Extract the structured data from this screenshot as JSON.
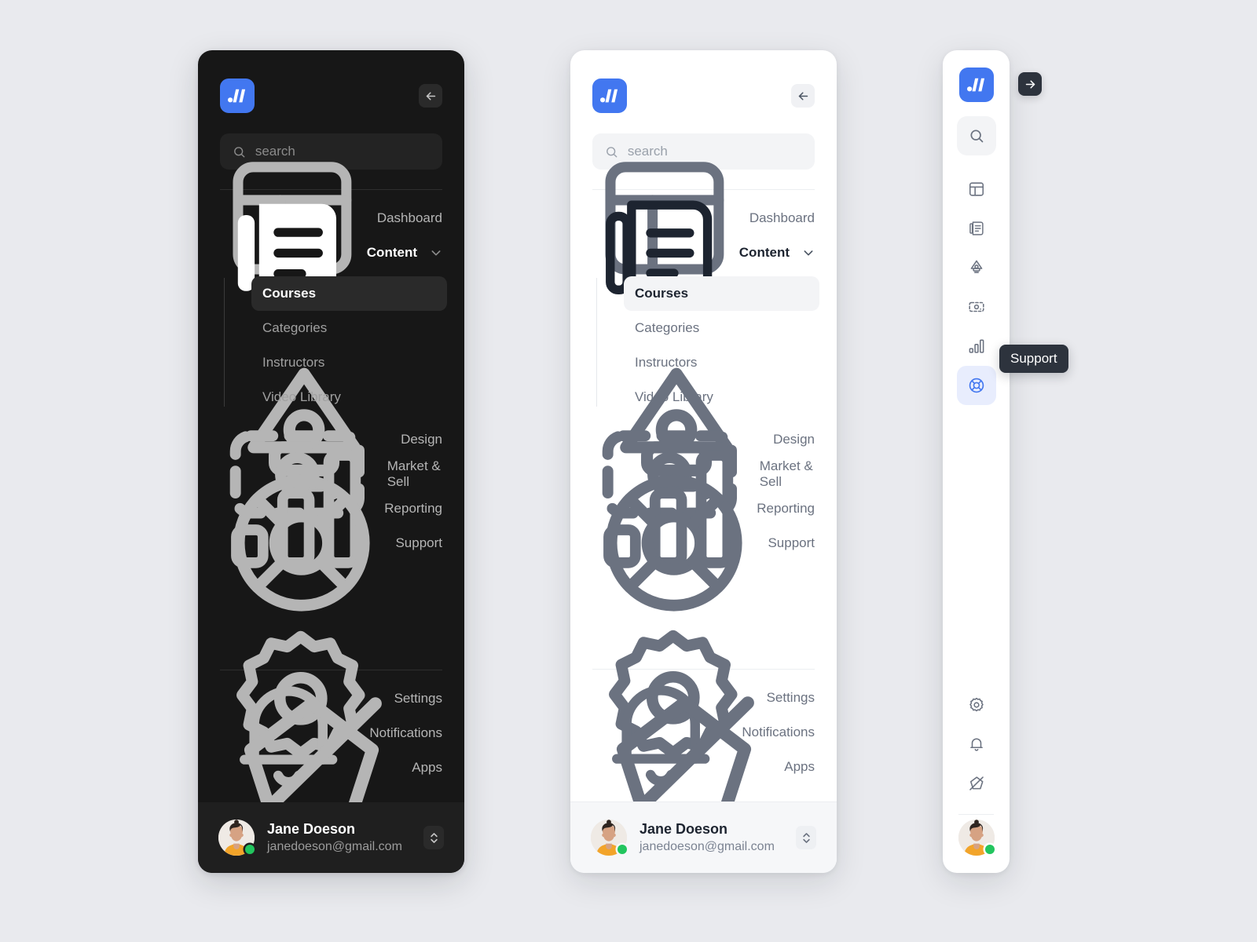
{
  "theme": {
    "page_bg": "#e9eaee",
    "brand_blue": "#4277f0",
    "dark_panel_bg": "#171717",
    "light_panel_bg": "#ffffff",
    "tooltip_bg": "#2d333d",
    "online_dot": "#22c55e",
    "selected_rail_bg": "#e8edfd"
  },
  "search": {
    "placeholder": "search",
    "value": "",
    "icon": "search-icon"
  },
  "header": {
    "logo_icon": "brand-logo-icon",
    "collapse_icon": "arrow-left-icon",
    "expand_icon": "arrow-right-icon"
  },
  "nav": {
    "primary": [
      {
        "label": "Dashboard",
        "icon": "layout-dashboard-icon",
        "active": false,
        "expandable": false
      },
      {
        "label": "Content",
        "icon": "document-stack-icon",
        "active": true,
        "expandable": true,
        "expanded": true,
        "chevron": "chevron-down-icon"
      },
      {
        "label": "Design",
        "icon": "pen-nib-icon",
        "active": false,
        "expandable": false
      },
      {
        "label": "Market & Sell",
        "icon": "banknote-icon",
        "active": false,
        "expandable": false
      },
      {
        "label": "Reporting",
        "icon": "bar-chart-icon",
        "active": false,
        "expandable": false
      },
      {
        "label": "Support",
        "icon": "lifebuoy-icon",
        "active": false,
        "expandable": false
      }
    ],
    "content_children": [
      {
        "label": "Courses",
        "active": true
      },
      {
        "label": "Categories",
        "active": false
      },
      {
        "label": "Instructors",
        "active": false
      },
      {
        "label": "Video Library",
        "active": false
      }
    ],
    "secondary": [
      {
        "label": "Settings",
        "icon": "gear-icon"
      },
      {
        "label": "Notifications",
        "icon": "bell-icon"
      },
      {
        "label": "Apps",
        "icon": "apps-icon"
      }
    ]
  },
  "user": {
    "name": "Jane Doeson",
    "email": "janedoeson@gmail.com",
    "status": "online",
    "avatar_icon": "user-avatar",
    "switcher_icon": "chevron-up-down-icon"
  },
  "rail": {
    "items": [
      {
        "icon": "search-icon",
        "name": "search",
        "selected": false,
        "boxed": true
      },
      {
        "icon": "layout-dashboard-icon",
        "name": "dashboard",
        "selected": false,
        "boxed": false
      },
      {
        "icon": "document-stack-icon",
        "name": "content",
        "selected": false,
        "boxed": false
      },
      {
        "icon": "pen-nib-icon",
        "name": "design",
        "selected": false,
        "boxed": false
      },
      {
        "icon": "banknote-icon",
        "name": "market-sell",
        "selected": false,
        "boxed": false
      },
      {
        "icon": "bar-chart-icon",
        "name": "reporting",
        "selected": false,
        "boxed": false
      },
      {
        "icon": "lifebuoy-icon",
        "name": "support",
        "selected": true,
        "boxed": true
      }
    ],
    "bottom_items": [
      {
        "icon": "gear-icon",
        "name": "settings"
      },
      {
        "icon": "bell-icon",
        "name": "notifications"
      },
      {
        "icon": "apps-icon",
        "name": "apps"
      }
    ],
    "tooltip": "Support"
  }
}
